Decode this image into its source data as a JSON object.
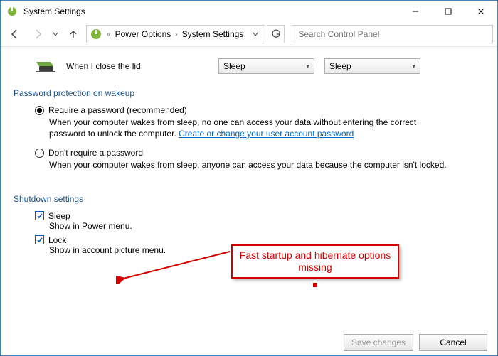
{
  "window": {
    "title": "System Settings"
  },
  "nav": {
    "breadcrumb": {
      "item1": "Power Options",
      "item2": "System Settings"
    },
    "search_placeholder": "Search Control Panel"
  },
  "lid": {
    "label": "When I close the lid:",
    "battery_value": "Sleep",
    "plugged_value": "Sleep"
  },
  "password_section": {
    "header": "Password protection on wakeup",
    "opt_require": {
      "label": "Require a password (recommended)",
      "desc_pre": "When your computer wakes from sleep, no one can access your data without entering the correct password to unlock the computer. ",
      "link": "Create or change your user account password"
    },
    "opt_norequire": {
      "label": "Don't require a password",
      "desc": "When your computer wakes from sleep, anyone can access your data because the computer isn't locked."
    }
  },
  "shutdown_section": {
    "header": "Shutdown settings",
    "sleep": {
      "label": "Sleep",
      "sub": "Show in Power menu."
    },
    "lock": {
      "label": "Lock",
      "sub": "Show in account picture menu."
    }
  },
  "footer": {
    "save": "Save changes",
    "cancel": "Cancel"
  },
  "annotation": {
    "text": "Fast startup and hibernate options missing"
  }
}
